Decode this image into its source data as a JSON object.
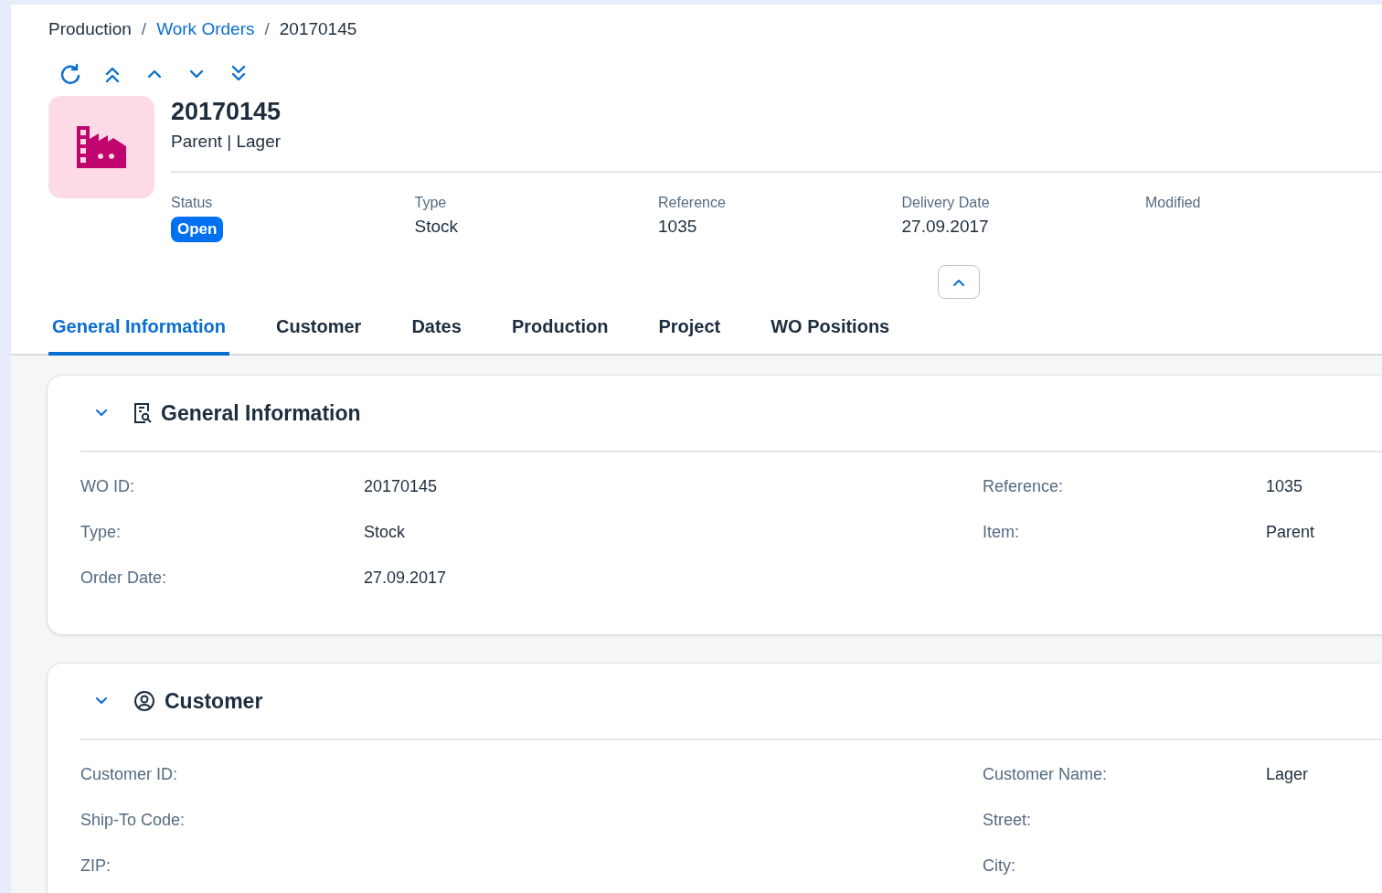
{
  "breadcrumb": [
    {
      "label": "Production",
      "kind": "text"
    },
    {
      "label": "Work Orders",
      "kind": "link",
      "separator": "/"
    },
    {
      "label": "20170145",
      "kind": "text",
      "separator": "/"
    }
  ],
  "header": {
    "title": "20170145",
    "subtitle": "Parent | Lager",
    "attributes": [
      {
        "label": "Status",
        "value": "Open",
        "kind": "status"
      },
      {
        "label": "Type",
        "value": "Stock",
        "kind": "text"
      },
      {
        "label": "Reference",
        "value": "1035",
        "kind": "text"
      },
      {
        "label": "Delivery Date",
        "value": "27.09.2017",
        "kind": "text"
      },
      {
        "label": "Modified"
      }
    ],
    "expanded": true
  },
  "tabs": [
    {
      "label": "General Information",
      "selected": true
    },
    {
      "label": "Customer",
      "selected": false
    },
    {
      "label": "Dates",
      "selected": false
    },
    {
      "label": "Production",
      "selected": false
    },
    {
      "label": "Project",
      "selected": false
    },
    {
      "label": "WO Positions",
      "selected": false
    }
  ],
  "sections": [
    {
      "title": "General Information",
      "kind": "info",
      "expanded": true,
      "fields_left": [
        {
          "label": "WO ID:",
          "value": "20170145"
        },
        {
          "label": "Type:",
          "value": "Stock"
        },
        {
          "label": "Order Date:",
          "value": "27.09.2017"
        }
      ],
      "fields_right": [
        {
          "label": "Reference:",
          "value": "1035"
        },
        {
          "label": "Item:",
          "value": "Parent"
        }
      ]
    },
    {
      "title": "Customer",
      "kind": "customer",
      "expanded": true,
      "fields_left": [
        {
          "label": "Customer ID:"
        },
        {
          "label": "Ship-To Code:"
        },
        {
          "label": "ZIP:"
        }
      ],
      "fields_right": [
        {
          "label": "Customer Name:",
          "value": "Lager"
        },
        {
          "label": "Street:"
        },
        {
          "label": "City:"
        }
      ]
    }
  ]
}
